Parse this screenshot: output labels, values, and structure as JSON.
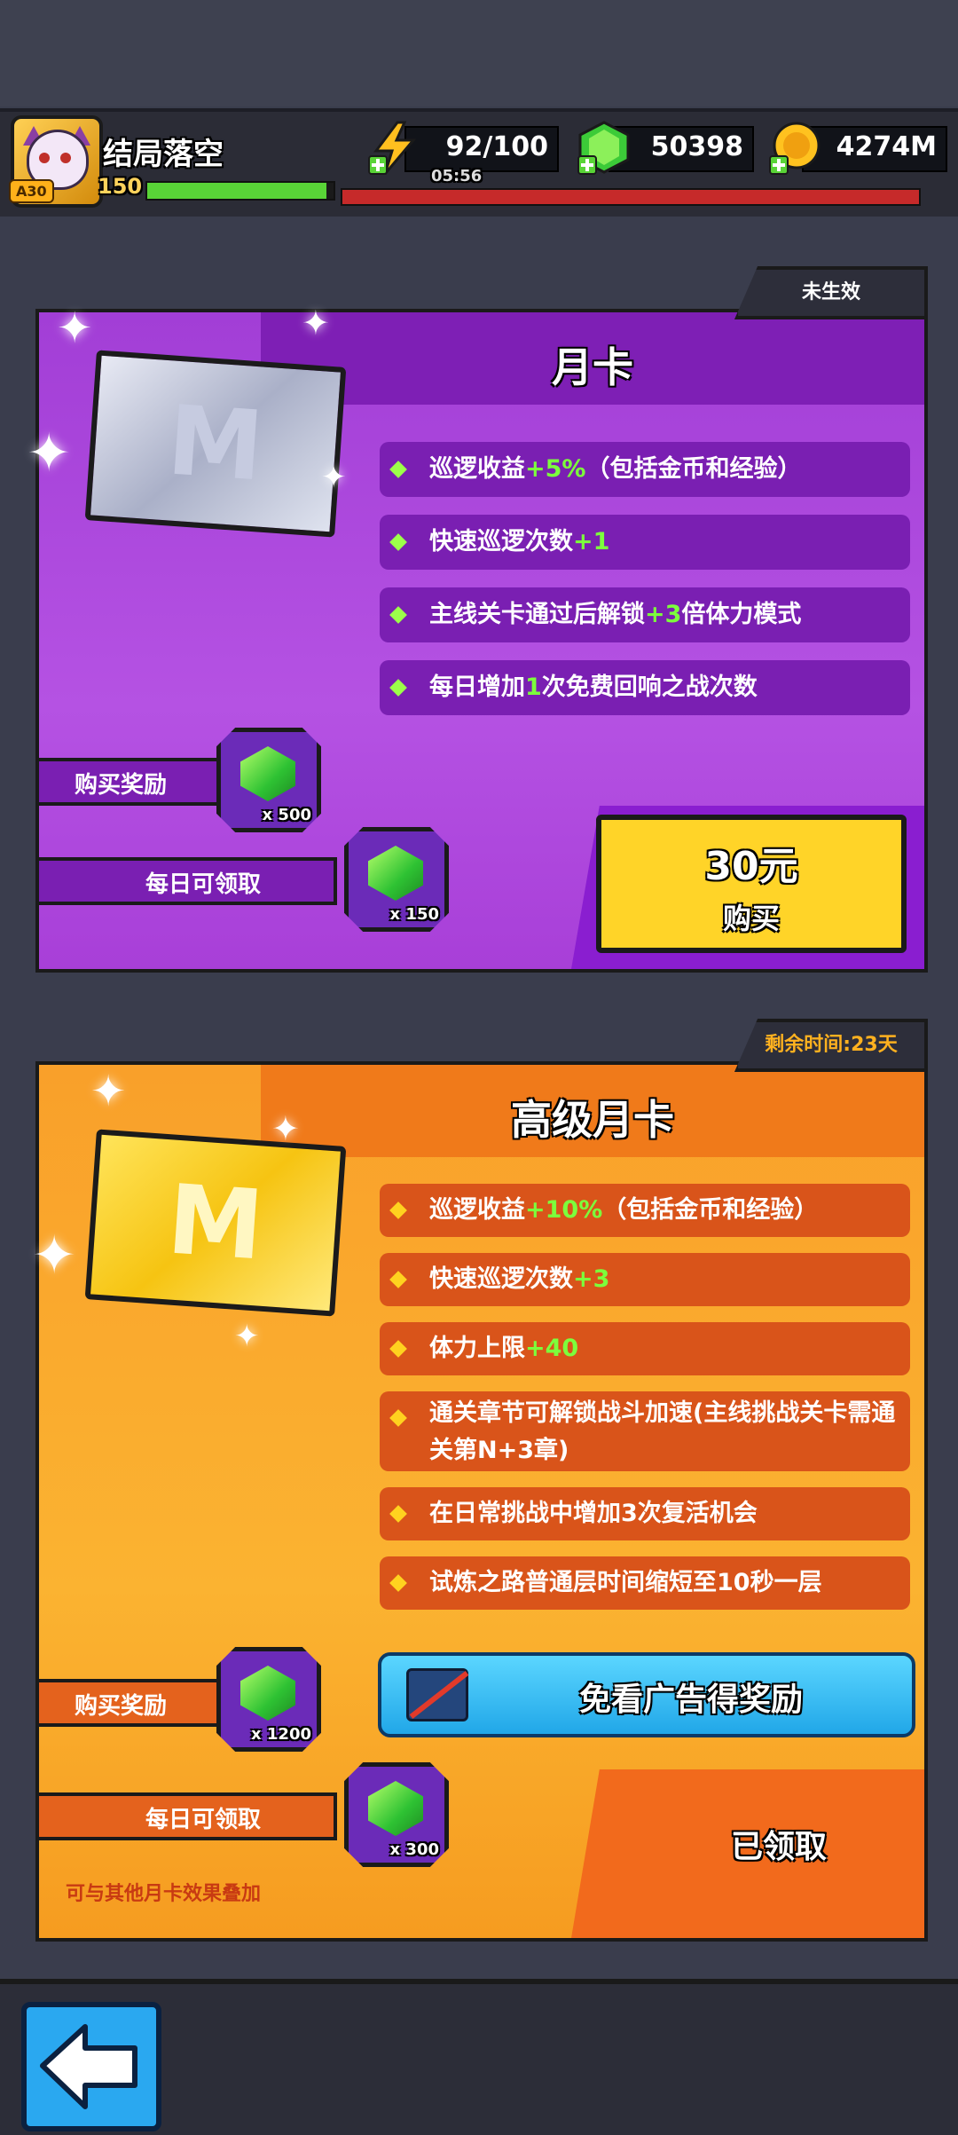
{
  "player": {
    "name": "结局落空",
    "level": "150",
    "badge": "A30",
    "xp_fraction": 0.96
  },
  "resources": {
    "stamina": "92/100",
    "stamina_timer": "05:56",
    "gems": "50398",
    "gold": "4274M"
  },
  "monthly_card": {
    "status": "未生效",
    "title": "月卡",
    "card_letter": "M",
    "features": [
      {
        "pre": "巡逻收益",
        "hl": "+5%",
        "post": "（包括金币和经验）"
      },
      {
        "pre": "快速巡逻次数",
        "hl": "+1",
        "post": ""
      },
      {
        "pre": "主线关卡通过后解锁",
        "hl": "+3",
        "post": "倍体力模式"
      },
      {
        "pre": "每日增加",
        "hl": "1",
        "post": "次免费回响之战次数"
      }
    ],
    "purchase_reward_label": "购买奖励",
    "purchase_reward_qty": "x 500",
    "daily_label": "每日可领取",
    "daily_qty": "x 150",
    "price": "30元",
    "buy_label": "购买"
  },
  "premium_card": {
    "remaining": "剩余时间:23天",
    "title": "高级月卡",
    "card_letter": "M",
    "features": [
      {
        "pre": "巡逻收益",
        "hl": "+10%",
        "post": "（包括金币和经验）"
      },
      {
        "pre": "快速巡逻次数",
        "hl": "+3",
        "post": ""
      },
      {
        "pre": "体力上限",
        "hl": "+40",
        "post": ""
      },
      {
        "pre": "通关章节可解锁战斗加速(主线挑战关卡需通关第N+3章)",
        "hl": "",
        "post": ""
      },
      {
        "pre": "在日常挑战中增加3次复活机会",
        "hl": "",
        "post": ""
      },
      {
        "pre": "试炼之路普通层时间缩短至10秒一层",
        "hl": "",
        "post": ""
      }
    ],
    "ad_free_label": "免看广告得奖励",
    "purchase_reward_label": "购买奖励",
    "purchase_reward_qty": "x 1200",
    "daily_label": "每日可领取",
    "daily_qty": "x 300",
    "claimed_label": "已领取",
    "stack_note": "可与其他月卡效果叠加"
  },
  "icons": {
    "stamina": "lightning-icon",
    "gems": "gem-icon",
    "gold": "coin-icon",
    "back": "back-arrow-icon"
  },
  "colors": {
    "monthly": "#a83fd8",
    "premium": "#fbb331",
    "highlight": "#7cff3c",
    "buy_button": "#ffd428"
  }
}
